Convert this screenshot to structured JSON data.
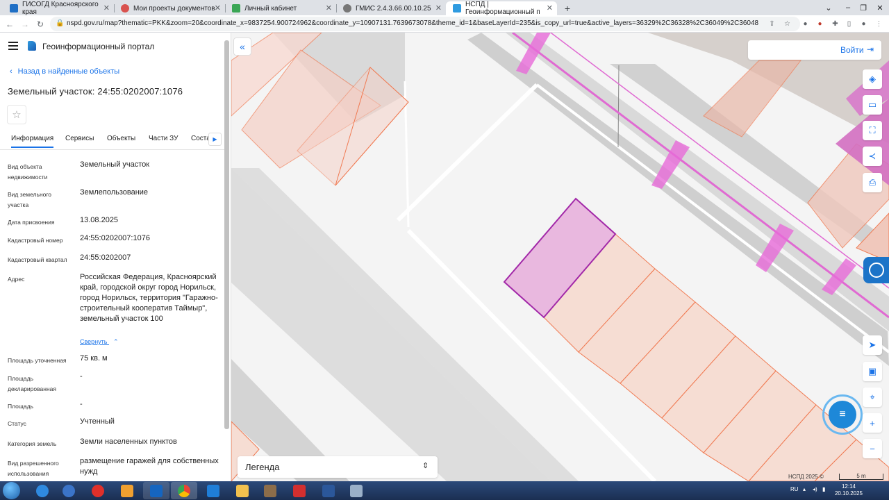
{
  "browser": {
    "tabs": [
      {
        "title": "ГИСОГД Красноярского края",
        "icon": "gisogd-favicon"
      },
      {
        "title": "Мои проекты документов",
        "icon": "docs-favicon"
      },
      {
        "title": "Личный кабинет",
        "icon": "cabinet-favicon"
      },
      {
        "title": "ГМИС 2.4.3.66.00.10.25",
        "icon": "gmis-favicon"
      },
      {
        "title": "НСПД | Геоинформационный п",
        "icon": "nspd-favicon"
      }
    ],
    "url": "nspd.gov.ru/map?thematic=PKK&zoom=20&coordinate_x=9837254.900724962&coordinate_y=10907131.7639673078&theme_id=1&baseLayerId=235&is_copy_url=true&active_layers=36329%2C36328%2C36049%2C36048"
  },
  "portal": {
    "title": "Геоинформационный портал"
  },
  "sidebar": {
    "back_label": "Назад в найденные объекты",
    "parcel_title": "Земельный участок: 24:55:0202007:1076",
    "tabs": [
      "Информация",
      "Сервисы",
      "Объекты",
      "Части ЗУ",
      "Соста"
    ],
    "collapse_label": "Свернуть",
    "fields": [
      {
        "label": "Вид объекта недвижимости",
        "value": "Земельный участок"
      },
      {
        "label": "Вид земельного участка",
        "value": "Землепользование"
      },
      {
        "label": "Дата присвоения",
        "value": "13.08.2025"
      },
      {
        "label": "Кадастровый номер",
        "value": "24:55:0202007:1076"
      },
      {
        "label": "Кадастровый квартал",
        "value": "24:55:0202007"
      },
      {
        "label": "Адрес",
        "value": "Российская Федерация, Красноярский край, городской округ город Норильск, город Норильск, территория \"Гаражно-строительный кооператив Таймыр\", земельный участок 100"
      },
      {
        "label": "Площадь уточненная",
        "value": "75 кв. м"
      },
      {
        "label": "Площадь декларированная",
        "value": "-"
      },
      {
        "label": "Площадь",
        "value": "-"
      },
      {
        "label": "Статус",
        "value": "Учтенный"
      },
      {
        "label": "Категория земель",
        "value": "Земли населенных пунктов"
      },
      {
        "label": "Вид разрешенного использования",
        "value": "размещение гаражей для собственных нужд"
      }
    ]
  },
  "map": {
    "login_label": "Войти",
    "legend_label": "Легенда",
    "copyright": "НСПД 2025 ©",
    "scale_label": "5 m",
    "selected_color": "#e9b8df",
    "parcel_stroke": "#f07a52"
  },
  "taskbar": {
    "lang": "RU",
    "time": "12:14",
    "date": "20.10.2025"
  }
}
